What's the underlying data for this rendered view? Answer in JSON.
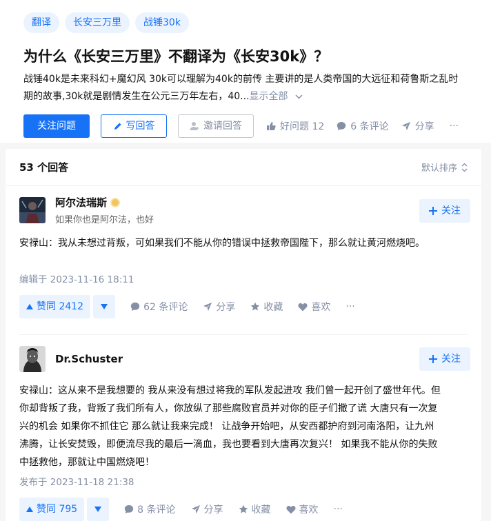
{
  "question": {
    "topics": [
      "翻译",
      "长安三万里",
      "战锤30k"
    ],
    "title": "为什么《长安三万里》不翻译为《长安30k》？",
    "desc_line1": "战锤40k是未来科幻+魔幻风 30k可以理解为40k的前传 主要讲的是人类帝国的大远征和荷鲁斯之乱时",
    "desc_line2": "期的故事,30k就是剧情发生在公元三万年左右，40...",
    "show_all": "显示全部",
    "follow_label": "关注问题",
    "write_label": "写回答",
    "invite_label": "邀请回答",
    "good_question": "好问题 12",
    "comments": "6 条评论",
    "share": "分享",
    "more": "···"
  },
  "answers_head": {
    "count": "53 个回答",
    "sort": "默认排序"
  },
  "answers": [
    {
      "author": "阿尔法瑞斯",
      "bio": "如果你也是阿尔法，也好",
      "follow": "关注",
      "content_lines": [
        "安禄山：我从未想过背叛，可如果我们不能从你的错误中拯救帝国陛下，那么就让黄河燃烧吧。"
      ],
      "date": "编辑于 2023-11-16 18:11",
      "vote": "赞同 2412",
      "comments": "62 条评论",
      "share": "分享",
      "collect": "收藏",
      "like": "喜欢",
      "more": "···"
    },
    {
      "author": "Dr.Schuster",
      "bio": "",
      "follow": "关注",
      "content_lines": [
        "安禄山：这从来不是我想要的 我从来没有想过将我的军队发起进攻 我们曾一起开创了盛世年代。但",
        "你却背叛了我，背叛了我们所有人，你放纵了那些腐败官员并对你的臣子们撒了谎 大唐只有一次复",
        "兴的机会 如果你不抓住它 那么就让我来完成！ 让战争开始吧，从安西都护府到河南洛阳，让九州",
        "沸腾，让长安焚毁，即便流尽我的最后一滴血，我也要看到大唐再次复兴！ 如果我不能从你的失败",
        "中拯救他，那就让中国燃烧吧！"
      ],
      "date": "发布于 2023-11-18 21:38",
      "vote": "赞同 795",
      "comments": "8 条评论",
      "share": "分享",
      "collect": "收藏",
      "like": "喜欢",
      "more": "···"
    }
  ],
  "colors": {
    "brand": "#1772f6",
    "muted": "#8590a6",
    "brand_light": "#ebf3ff"
  }
}
